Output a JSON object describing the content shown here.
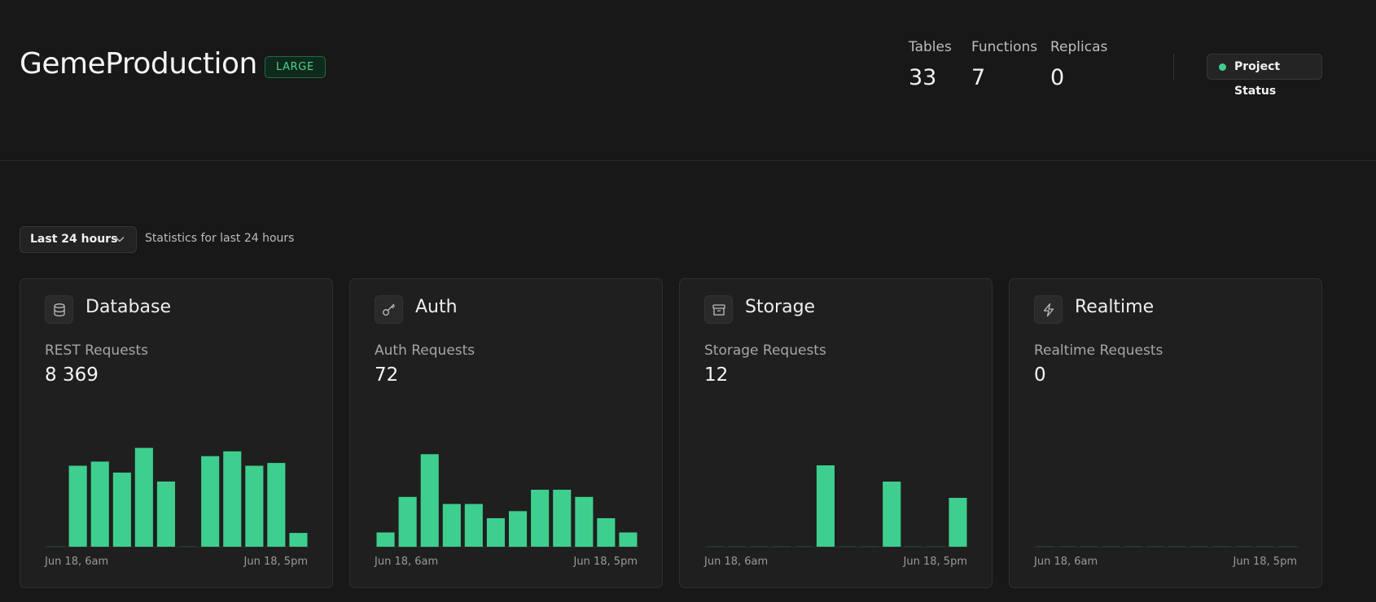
{
  "header": {
    "project_name": "GemeProduction",
    "size_badge": "LARGE",
    "stats": [
      {
        "label": "Tables",
        "value": "33"
      },
      {
        "label": "Functions",
        "value": "7"
      },
      {
        "label": "Replicas",
        "value": "0"
      }
    ],
    "status_button": "Project Status"
  },
  "filter": {
    "range_label": "Last 24 hours",
    "caption": "Statistics for last 24 hours"
  },
  "colors": {
    "accent": "#3ecf8e",
    "background": "#181818",
    "card": "#1f1f1f"
  },
  "cards": [
    {
      "title": "Database",
      "icon": "database-icon",
      "metric_label": "REST Requests",
      "metric_value": "8 369",
      "x_start": "Jun 18, 6am",
      "x_end": "Jun 18, 5pm"
    },
    {
      "title": "Auth",
      "icon": "key-icon",
      "metric_label": "Auth Requests",
      "metric_value": "72",
      "x_start": "Jun 18, 6am",
      "x_end": "Jun 18, 5pm"
    },
    {
      "title": "Storage",
      "icon": "archive-icon",
      "metric_label": "Storage Requests",
      "metric_value": "12",
      "x_start": "Jun 18, 6am",
      "x_end": "Jun 18, 5pm"
    },
    {
      "title": "Realtime",
      "icon": "lightning-icon",
      "metric_label": "Realtime Requests",
      "metric_value": "0",
      "x_start": "Jun 18, 6am",
      "x_end": "Jun 18, 5pm"
    }
  ],
  "chart_data": [
    {
      "type": "bar",
      "x_tick_labels": [
        "Jun 18, 6am",
        "Jun 18, 5pm"
      ],
      "values": [
        0,
        1180,
        1240,
        1080,
        1440,
        950,
        0,
        1320,
        1390,
        1180,
        1220,
        200
      ],
      "ylim": [
        0,
        1660
      ],
      "color": "#3ecf8e"
    },
    {
      "type": "bar",
      "x_tick_labels": [
        "Jun 18, 6am",
        "Jun 18, 5pm"
      ],
      "values": [
        2,
        7,
        13,
        6,
        6,
        4,
        5,
        8,
        8,
        7,
        4,
        2
      ],
      "ylim": [
        0,
        16
      ],
      "color": "#3ecf8e"
    },
    {
      "type": "bar",
      "x_tick_labels": [
        "Jun 18, 6am",
        "Jun 18, 5pm"
      ],
      "values": [
        0,
        0,
        0,
        0,
        0,
        5,
        0,
        0,
        4,
        0,
        0,
        3
      ],
      "ylim": [
        0,
        7
      ],
      "color": "#3ecf8e"
    },
    {
      "type": "bar",
      "x_tick_labels": [
        "Jun 18, 6am",
        "Jun 18, 5pm"
      ],
      "values": [
        0,
        0,
        0,
        0,
        0,
        0,
        0,
        0,
        0,
        0,
        0,
        0
      ],
      "ylim": [
        0,
        1
      ],
      "color": "#3ecf8e"
    }
  ]
}
